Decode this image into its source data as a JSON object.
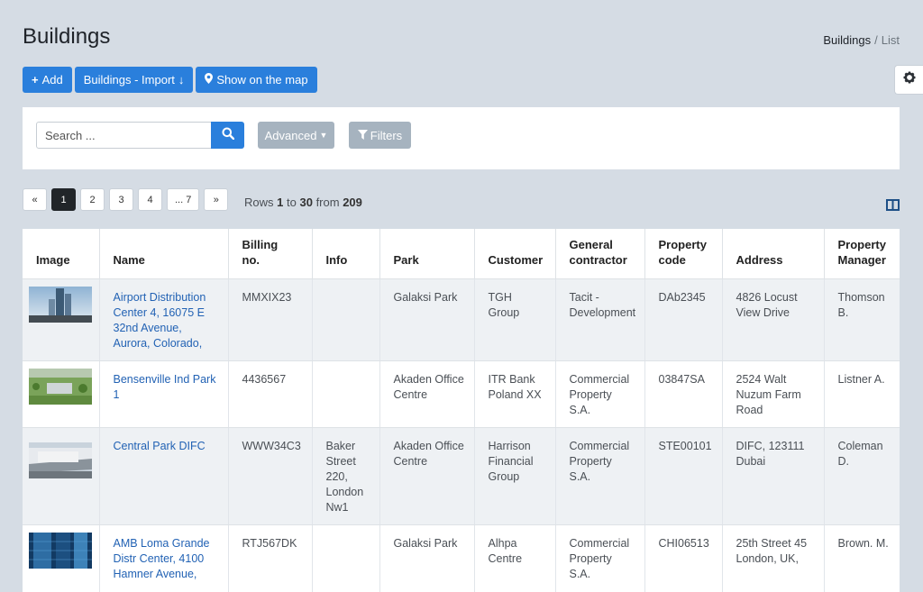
{
  "page": {
    "title": "Buildings",
    "breadcrumb": {
      "parent": "Buildings",
      "separator": "/",
      "current": "List"
    }
  },
  "toolbar": {
    "add_label": "Add",
    "import_label": "Buildings - Import",
    "map_label": "Show on the map"
  },
  "search": {
    "placeholder": "Search ...",
    "advanced_label": "Advanced",
    "filters_label": "Filters"
  },
  "pagination": {
    "prev": "«",
    "pages": [
      "1",
      "2",
      "3",
      "4",
      "... 7"
    ],
    "next": "»",
    "active_page": "1",
    "rows_prefix": "Rows",
    "rows_from": "1",
    "rows_to_word": "to",
    "rows_to": "30",
    "rows_from_word": "from",
    "rows_total": "209"
  },
  "table": {
    "headers": [
      "Image",
      "Name",
      "Billing no.",
      "Info",
      "Park",
      "Customer",
      "General contractor",
      "Property code",
      "Address",
      "Property Manager"
    ],
    "rows": [
      {
        "image": "building-tower-photo",
        "name": "Airport Distribution Center 4, 16075 E 32nd Avenue, Aurora, Colorado,",
        "billing": "MMXIX23",
        "info": "",
        "park": "Galaksi Park",
        "customer": "TGH Group",
        "contractor": "Tacit - Development",
        "code": "DAb2345",
        "address": "4826 Locust View Drive",
        "manager": "Thomson B."
      },
      {
        "image": "aerial-field-photo",
        "name": "Bensenville Ind Park 1",
        "billing": "4436567",
        "info": "",
        "park": "Akaden Office Centre",
        "customer": "ITR Bank Poland XX",
        "contractor": "Commercial Property S.A.",
        "code": "03847SA",
        "address": "2524 Walt Nuzum Farm Road",
        "manager": "Listner A."
      },
      {
        "image": "warehouse-photo",
        "name": "Central Park DIFC",
        "billing": "WWW34C3",
        "info": "Baker Street 220, London Nw1",
        "park": "Akaden Office Centre",
        "customer": "Harrison Financial Group",
        "contractor": "Commercial Property S.A.",
        "code": "STE00101",
        "address": "DIFC, 123111 Dubai",
        "manager": "Coleman D."
      },
      {
        "image": "glass-tower-photo",
        "name": "AMB Loma Grande Distr Center, 4100 Hamner Avenue,",
        "billing": "RTJ567DK",
        "info": "",
        "park": "Galaksi Park",
        "customer": "Alhpa Centre",
        "contractor": "Commercial Property S.A.",
        "code": "CHI06513",
        "address": "25th Street 45 London, UK,",
        "manager": "Brown. M."
      }
    ]
  },
  "colors": {
    "primary": "#2a7fdc",
    "muted_button": "#a6b3bf",
    "background": "#d5dce4",
    "link": "#2262b4",
    "active_page": "#212529"
  }
}
